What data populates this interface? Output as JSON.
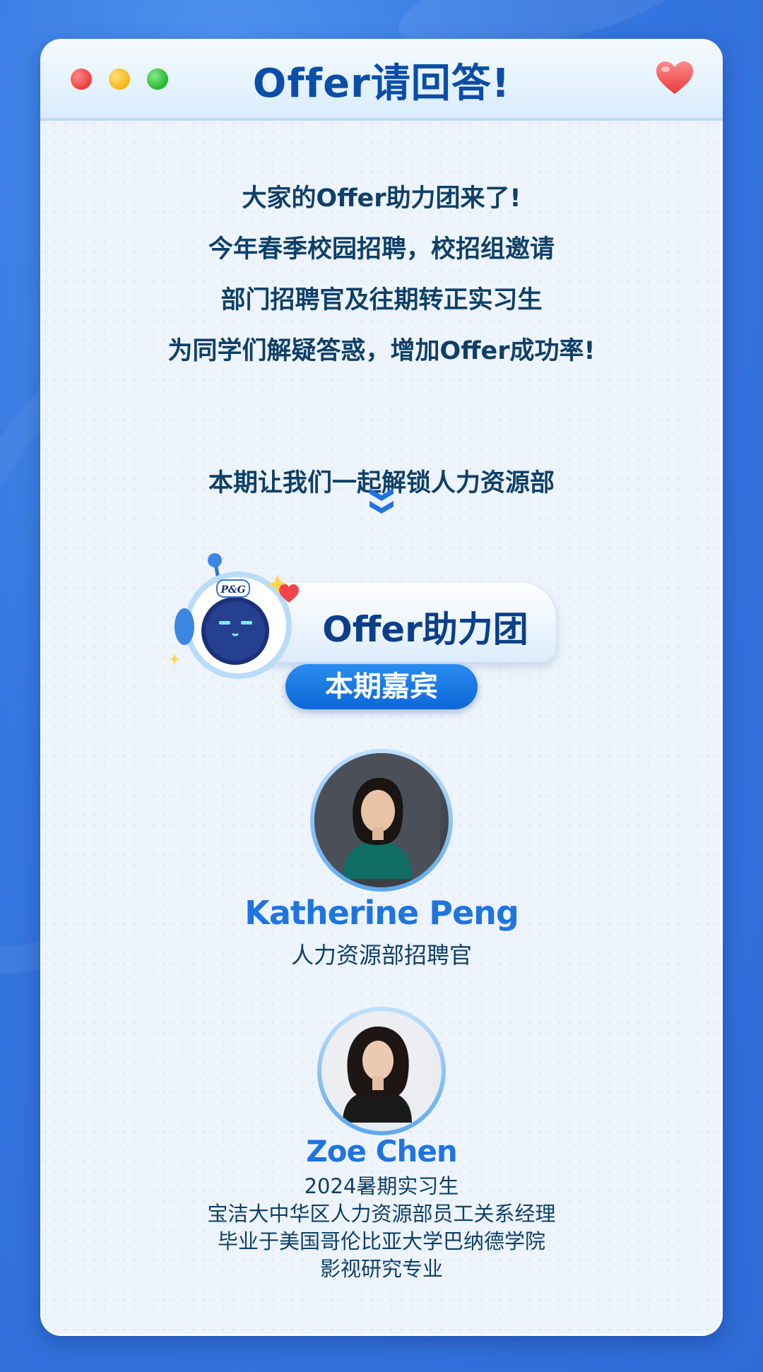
{
  "header": {
    "title": "Offer请回答!"
  },
  "intro": {
    "lines": [
      "大家的Offer助力团来了!",
      "今年春季校园招聘，校招组邀请",
      "部门招聘官及往期转正实习生",
      "为同学们解疑答惑，增加Offer成功率!"
    ],
    "unlock": "本期让我们一起解锁人力资源部"
  },
  "banner": {
    "text": "Offer助力团",
    "robot_badge": "P&G"
  },
  "guests": {
    "tag": "本期嘉宾",
    "list": [
      {
        "name": "Katherine Peng",
        "lines": [
          "人力资源部招聘官"
        ]
      },
      {
        "name": "Zoe Chen",
        "lines": [
          "2024暑期实习生",
          "宝洁大中华区人力资源部员工关系经理",
          "毕业于美国哥伦比亚大学巴纳德学院",
          "影视研究专业"
        ]
      }
    ]
  },
  "colors": {
    "background": "#3577e0",
    "title": "#0b4ea8",
    "body_text": "#0e4068",
    "accent": "#1f74e0"
  },
  "icons": [
    "window-red-dot",
    "window-yellow-dot",
    "window-green-dot",
    "heart-icon",
    "double-chevron-down-icon",
    "robot-mascot-icon",
    "sparkle-icon"
  ]
}
